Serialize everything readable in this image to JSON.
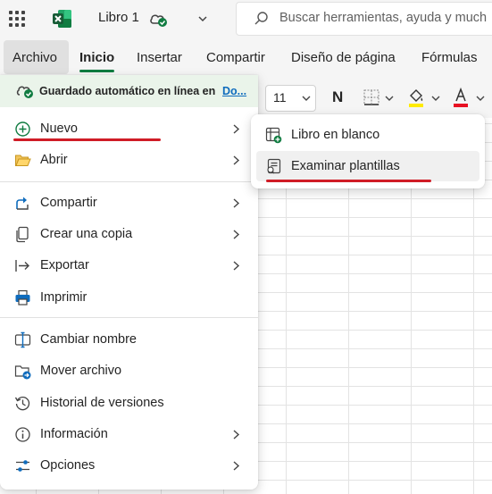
{
  "app": {
    "workbook_title": "Libro 1",
    "search_placeholder": "Buscar herramientas, ayuda y much"
  },
  "ribbon": {
    "tabs": [
      {
        "label": "Archivo",
        "state": "open"
      },
      {
        "label": "Inicio",
        "state": "active"
      },
      {
        "label": "Insertar"
      },
      {
        "label": "Compartir"
      },
      {
        "label": "Diseño de página"
      },
      {
        "label": "Fórmulas"
      }
    ],
    "font_size": "11",
    "bold_label": "N"
  },
  "file_menu": {
    "autosave_text": "Guardado automático en línea en",
    "autosave_link": "Do...",
    "items": [
      {
        "label": "Nuevo",
        "icon": "plus-circle-icon",
        "has_submenu": true,
        "highlighted": true
      },
      {
        "label": "Abrir",
        "icon": "folder-open-icon",
        "has_submenu": true
      },
      {
        "label": "Compartir",
        "icon": "share-icon",
        "has_submenu": true
      },
      {
        "label": "Crear una copia",
        "icon": "copy-icon",
        "has_submenu": true
      },
      {
        "label": "Exportar",
        "icon": "export-icon",
        "has_submenu": true
      },
      {
        "label": "Imprimir",
        "icon": "printer-icon",
        "has_submenu": false
      },
      {
        "label": "Cambiar nombre",
        "icon": "rename-icon",
        "has_submenu": false
      },
      {
        "label": "Mover archivo",
        "icon": "move-folder-icon",
        "has_submenu": false
      },
      {
        "label": "Historial de versiones",
        "icon": "history-icon",
        "has_submenu": false
      },
      {
        "label": "Información",
        "icon": "info-icon",
        "has_submenu": true
      },
      {
        "label": "Opciones",
        "icon": "options-icon",
        "has_submenu": true
      }
    ]
  },
  "submenu": {
    "items": [
      {
        "label": "Libro en blanco",
        "icon": "blank-workbook-icon"
      },
      {
        "label": "Examinar plantillas",
        "icon": "templates-icon",
        "highlighted": true
      }
    ]
  },
  "colors": {
    "excel_green": "#107c41",
    "annotation_red": "#d01c26",
    "link_blue": "#0f6cbd",
    "fill_yellow": "#ffeb00",
    "font_red": "#e81123"
  }
}
